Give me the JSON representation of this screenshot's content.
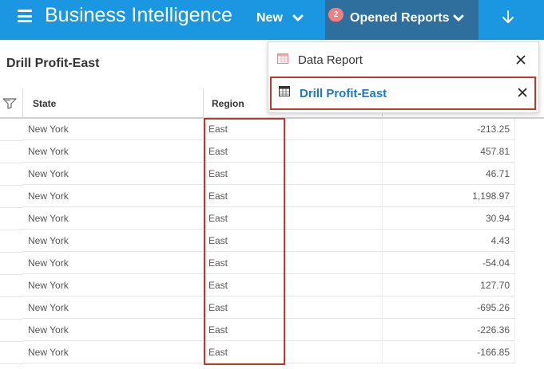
{
  "header": {
    "app_title": "Business Intelligence",
    "new_label": "New",
    "opened_reports_label": "Opened Reports",
    "opened_reports_count": "2"
  },
  "page": {
    "title": "Drill Profit-East"
  },
  "table": {
    "columns": [
      "State",
      "Region"
    ],
    "rows": [
      [
        "New York",
        "East",
        "-213.25"
      ],
      [
        "New York",
        "East",
        "457.81"
      ],
      [
        "New York",
        "East",
        "46.71"
      ],
      [
        "New York",
        "East",
        "1,198.97"
      ],
      [
        "New York",
        "East",
        "30.94"
      ],
      [
        "New York",
        "East",
        "4.43"
      ],
      [
        "New York",
        "East",
        "-54.04"
      ],
      [
        "New York",
        "East",
        "127.70"
      ],
      [
        "New York",
        "East",
        "-695.26"
      ],
      [
        "New York",
        "East",
        "-226.36"
      ],
      [
        "New York",
        "East",
        "-166.85"
      ]
    ]
  },
  "opened_reports": {
    "items": [
      {
        "label": "Data Report",
        "icon": "report-icon",
        "selected": false
      },
      {
        "label": "Drill Profit-East",
        "icon": "table-icon",
        "selected": true
      }
    ]
  },
  "colors": {
    "topbar": "#1b96e0",
    "active_menu": "#2e6f9e",
    "highlight": "#c0392b",
    "link": "#1b78c8"
  }
}
